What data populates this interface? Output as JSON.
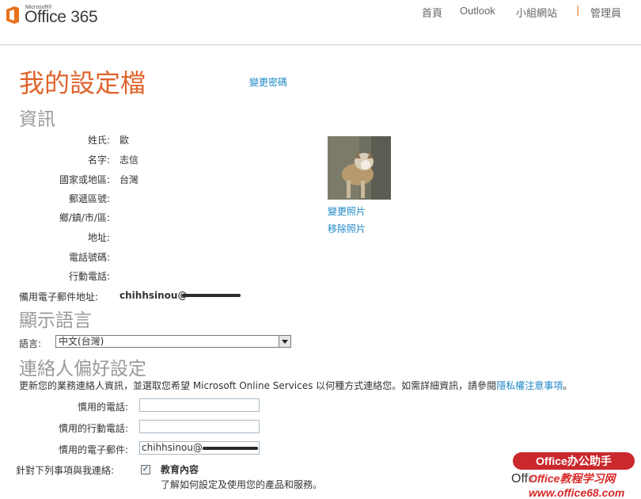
{
  "header": {
    "logo_small": "Microsoft®",
    "logo_text": "Office 365",
    "nav": [
      "首頁",
      "Outlook",
      "小組網站",
      "管理員"
    ]
  },
  "page": {
    "title": "我的設定檔",
    "change_password": "變更密碼"
  },
  "info": {
    "heading": "資訊",
    "fields": [
      {
        "label": "姓氏:",
        "value": "歐"
      },
      {
        "label": "名字:",
        "value": "志信"
      },
      {
        "label": "國家或地區:",
        "value": "台灣"
      },
      {
        "label": "郵遞區號:",
        "value": ""
      },
      {
        "label": "鄉/鎮/市/區:",
        "value": ""
      },
      {
        "label": "地址:",
        "value": ""
      },
      {
        "label": "電話號碼:",
        "value": ""
      },
      {
        "label": "行動電話:",
        "value": ""
      }
    ],
    "alt_email_label": "備用電子郵件地址:",
    "alt_email_value": "chihhsinou@",
    "change_photo": "變更照片",
    "remove_photo": "移除照片"
  },
  "language": {
    "heading": "顯示語言",
    "label": "語言:",
    "selected": "中文(台灣)"
  },
  "contact": {
    "heading": "連絡人偏好設定",
    "description": "更新您的業務連絡人資訊，並選取您希望 Microsoft Online Services 以何種方式連絡您。如需詳細資訊，請參閱",
    "privacy_link": "隱私權注意事項",
    "description_end": "。",
    "phone_label": "慣用的電話:",
    "phone_value": "",
    "mobile_label": "慣用的行動電話:",
    "mobile_value": "",
    "email_label": "慣用的電子郵件:",
    "email_value": "chihhsinou@",
    "contact_me_label": "針對下列事項與我連絡:",
    "edu_title": "教育內容",
    "edu_desc": "了解如何設定及使用您的產品和服務。",
    "edu_checked": true
  },
  "watermark": {
    "badge": "Office办公助手",
    "url": "Office教程学习网 www.office68.com",
    "under": "Offic"
  }
}
